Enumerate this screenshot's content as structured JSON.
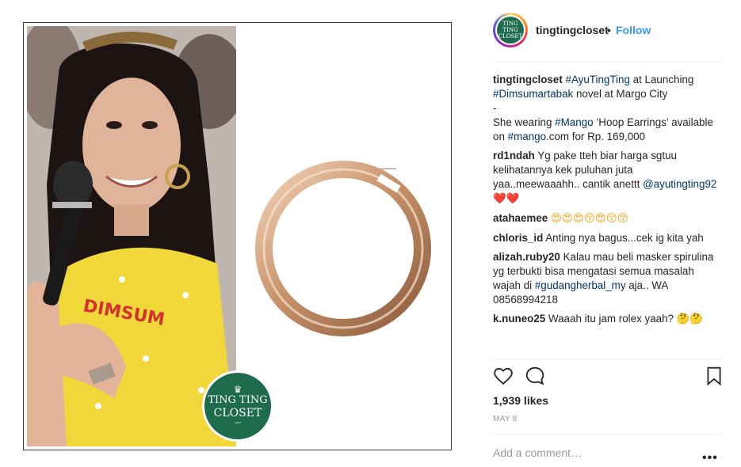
{
  "post": {
    "username": "tingtingcloset",
    "follow_label": "Follow",
    "dot": "•",
    "avatar_logo_line1": "TING TING",
    "avatar_logo_line2": "CLOSET",
    "watermark_line1": "TING TING",
    "watermark_line2": "CLOSET",
    "caption": {
      "user": "tingtingcloset",
      "tag1": "#AyuTingTing",
      "text1": " at Launching ",
      "tag2": "#Dimsumartabak",
      "text2": " novel at Margo City",
      "dash": "-",
      "text3": "She wearing ",
      "tag3": "#Mango",
      "text4": " ‘Hoop Earrings’ available on ",
      "tag4": "#mango",
      "text5": ".com for Rp. 169,000"
    },
    "comments": [
      {
        "user": "rd1ndah",
        "text": "Yg pake tteh biar harga sgtuu kelihatannya kek puluhan juta yaa..meewaaahh.. cantik anettt ",
        "mention": "@ayutingting92",
        "emoji": "❤️❤️"
      },
      {
        "user": "atahaemee",
        "text": "",
        "emoji": "😍😍😍😚😍😚😚"
      },
      {
        "user": "chloris_id",
        "text": "Anting nya bagus...cek ig kita yah",
        "emoji": ""
      },
      {
        "user": "alizah.ruby20",
        "text": "Kalau mau beli masker spirulina yg terbukti bisa mengatasi semua masalah wajah di ",
        "tag": "#gudangherbal_my",
        "text2": " aja.. WA 08568994218",
        "emoji": ""
      },
      {
        "user": "k.nuneo25",
        "text": "Waaah itu jam rolex yaah? ",
        "emoji": "🤔🤔"
      }
    ],
    "likes": "1,939 likes",
    "date": "MAY 8",
    "add_comment_placeholder": "Add a comment…",
    "more_label": "•••"
  },
  "icons": {
    "like": "heart-icon",
    "comment": "comment-icon",
    "save": "bookmark-icon",
    "more": "more-options-icon"
  },
  "colors": {
    "link": "#003569",
    "follow": "#3897f0",
    "brand_green": "#1f6b4e"
  }
}
